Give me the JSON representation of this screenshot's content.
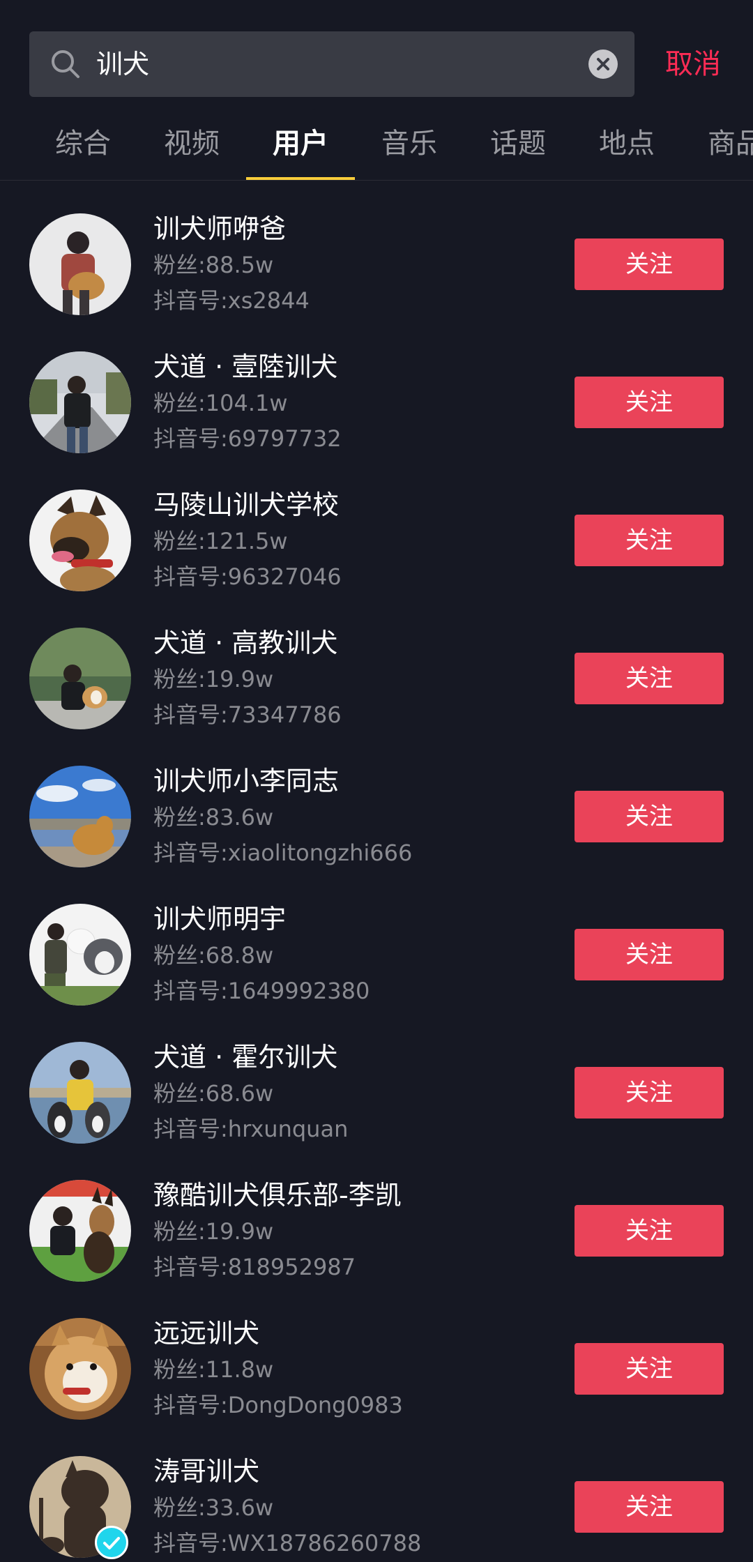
{
  "search": {
    "query": "训犬",
    "cancel_label": "取消",
    "search_icon": "search-icon",
    "clear_icon": "clear-icon"
  },
  "colors": {
    "background": "#161823",
    "accent": "#fe2c55",
    "follow_button": "#ea4359",
    "tab_indicator": "#facd3a",
    "verified_badge": "#20d5ec"
  },
  "tabs": [
    {
      "label": "综合",
      "active": false
    },
    {
      "label": "视频",
      "active": false
    },
    {
      "label": "用户",
      "active": true
    },
    {
      "label": "音乐",
      "active": false
    },
    {
      "label": "话题",
      "active": false
    },
    {
      "label": "地点",
      "active": false
    },
    {
      "label": "商品",
      "active": false
    }
  ],
  "users": [
    {
      "name": "训犬师咿爸",
      "fans": "粉丝:88.5w",
      "account": "抖音号:xs2844",
      "follow_label": "关注",
      "verified": false
    },
    {
      "name": "犬道 · 壹陸训犬",
      "fans": "粉丝:104.1w",
      "account": "抖音号:69797732",
      "follow_label": "关注",
      "verified": false
    },
    {
      "name": "马陵山训犬学校",
      "fans": "粉丝:121.5w",
      "account": "抖音号:96327046",
      "follow_label": "关注",
      "verified": false
    },
    {
      "name": "犬道 · 高教训犬",
      "fans": "粉丝:19.9w",
      "account": "抖音号:73347786",
      "follow_label": "关注",
      "verified": false
    },
    {
      "name": "训犬师小李同志",
      "fans": "粉丝:83.6w",
      "account": "抖音号:xiaolitongzhi666",
      "follow_label": "关注",
      "verified": false
    },
    {
      "name": "训犬师明宇",
      "fans": "粉丝:68.8w",
      "account": "抖音号:1649992380",
      "follow_label": "关注",
      "verified": false
    },
    {
      "name": "犬道 · 霍尔训犬",
      "fans": "粉丝:68.6w",
      "account": "抖音号:hrxunquan",
      "follow_label": "关注",
      "verified": false
    },
    {
      "name": "豫酷训犬俱乐部-李凯",
      "fans": "粉丝:19.9w",
      "account": "抖音号:818952987",
      "follow_label": "关注",
      "verified": false
    },
    {
      "name": "远远训犬",
      "fans": "粉丝:11.8w",
      "account": "抖音号:DongDong0983",
      "follow_label": "关注",
      "verified": false
    },
    {
      "name": "涛哥训犬",
      "fans": "粉丝:33.6w",
      "account": "抖音号:WX18786260788",
      "follow_label": "关注",
      "verified": true
    }
  ]
}
